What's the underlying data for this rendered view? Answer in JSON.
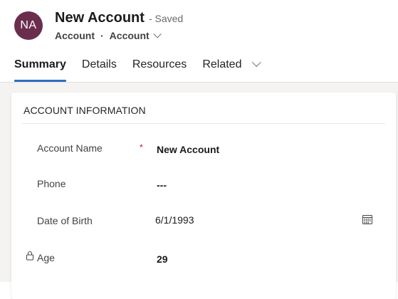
{
  "header": {
    "avatar_initials": "NA",
    "avatar_color": "#6b2d4e",
    "title": "New Account",
    "save_status": "- Saved",
    "entity": "Account",
    "separator": "·",
    "form_selector": "Account"
  },
  "tabs": [
    {
      "label": "Summary",
      "active": true
    },
    {
      "label": "Details",
      "active": false
    },
    {
      "label": "Resources",
      "active": false
    },
    {
      "label": "Related",
      "active": false,
      "has_dropdown": true
    }
  ],
  "section": {
    "title": "ACCOUNT INFORMATION",
    "fields": {
      "account_name": {
        "label": "Account Name",
        "required_marker": "*",
        "value": "New Account"
      },
      "phone": {
        "label": "Phone",
        "value": "---"
      },
      "dob": {
        "label": "Date of Birth",
        "value": "6/1/1993",
        "icon": "calendar-icon"
      },
      "age": {
        "label": "Age",
        "value": "29",
        "icon": "lock-icon"
      }
    }
  },
  "colors": {
    "accent": "#2f6fbf",
    "required": "#c50f1f"
  }
}
